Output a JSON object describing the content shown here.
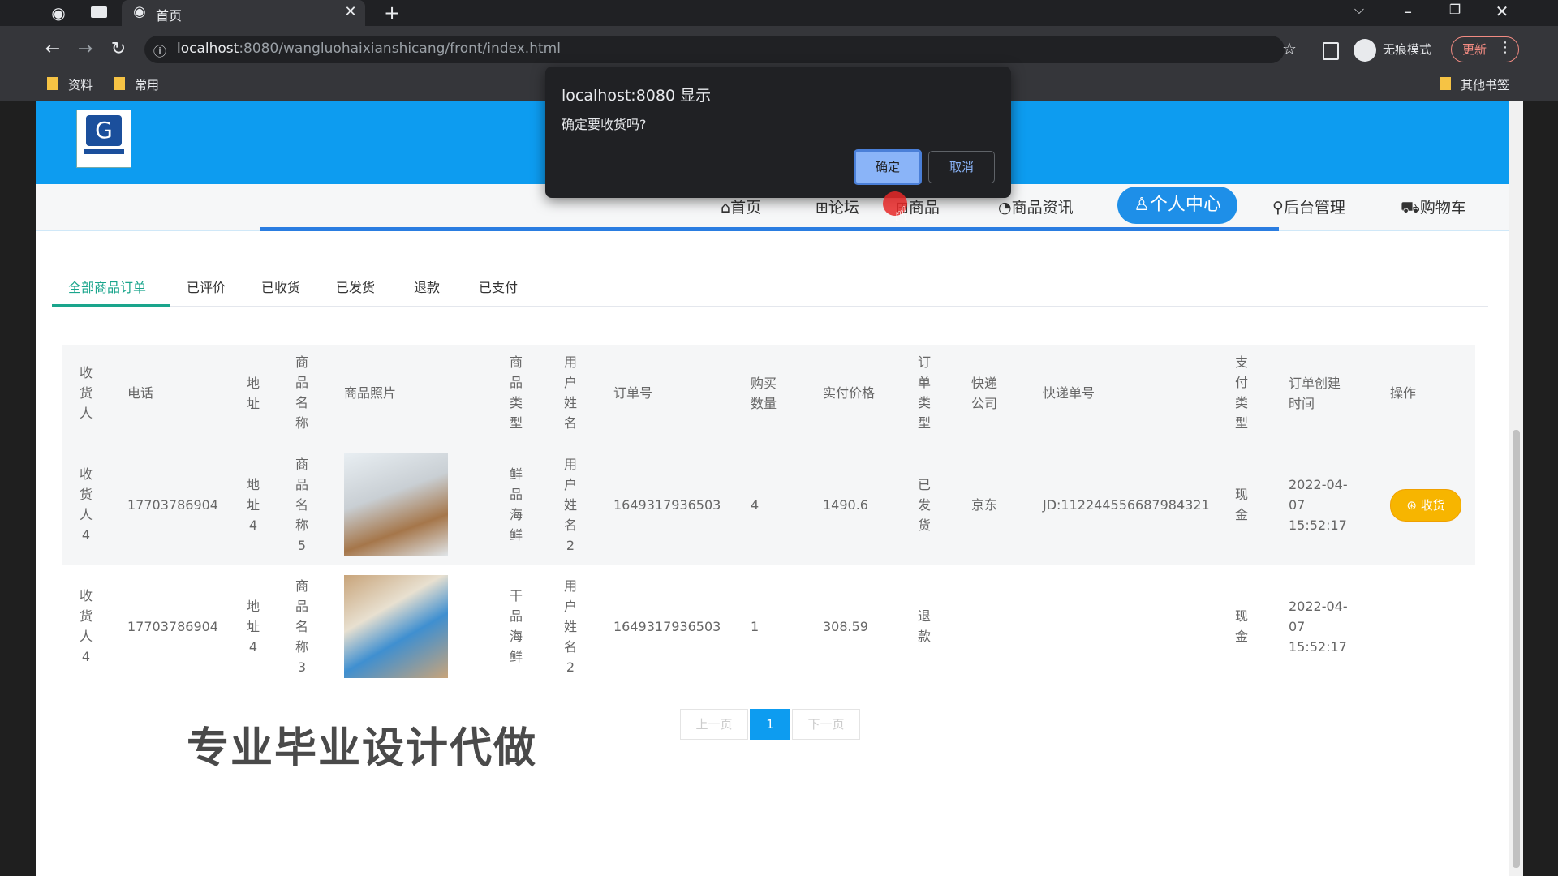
{
  "browser": {
    "tab_title": "首页",
    "url_host": "localhost",
    "url_rest": ":8080/wangluohaixianshicang/front/index.html",
    "incognito_label": "无痕模式",
    "update_label": "更新",
    "bookmarks": [
      "资料",
      "常用"
    ],
    "other_bookmarks": "其他书签"
  },
  "nav": {
    "home": "首页",
    "forum": "论坛",
    "products": "商品",
    "news": "商品资讯",
    "personal": "个人中心",
    "admin": "后台管理",
    "cart": "购物车"
  },
  "order_tabs": [
    "全部商品订单",
    "已评价",
    "已收货",
    "已发货",
    "退款",
    "已支付"
  ],
  "table": {
    "headers": [
      "收货人",
      "电话",
      "地址",
      "商品名称",
      "商品照片",
      "商品类型",
      "用户姓名",
      "订单号",
      "购买数量",
      "实付价格",
      "订单类型",
      "快递公司",
      "快递单号",
      "支付类型",
      "订单创建时间",
      "操作"
    ],
    "rows": [
      {
        "receiver": "收货人4",
        "phone": "17703786904",
        "address": "地址4",
        "product_name": "商品名称5",
        "product_type": "鲜品海鲜",
        "user_name": "用户姓名2",
        "order_no": "1649317936503",
        "quantity": "4",
        "price": "1490.6",
        "order_type": "已发货",
        "courier": "京东",
        "tracking_no": "JD:112244556687984321",
        "pay_type": "现金",
        "created": "2022-04-07 15:52:17",
        "action": "收货"
      },
      {
        "receiver": "收货人4",
        "phone": "17703786904",
        "address": "地址4",
        "product_name": "商品名称3",
        "product_type": "干品海鲜",
        "user_name": "用户姓名2",
        "order_no": "1649317936503",
        "quantity": "1",
        "price": "308.59",
        "order_type": "退款",
        "courier": "",
        "tracking_no": "",
        "pay_type": "现金",
        "created": "2022-04-07 15:52:17",
        "action": ""
      }
    ]
  },
  "pagination": {
    "prev": "上一页",
    "current": "1",
    "next": "下一页"
  },
  "watermark": "专业毕业设计代做",
  "dialog": {
    "title": "localhost:8080 显示",
    "message": "确定要收货吗?",
    "ok": "确定",
    "cancel": "取消"
  },
  "colors": {
    "header_blue": "#0d9cf0",
    "accent_green": "#1aa58c",
    "receive_orange": "#f7b500"
  }
}
